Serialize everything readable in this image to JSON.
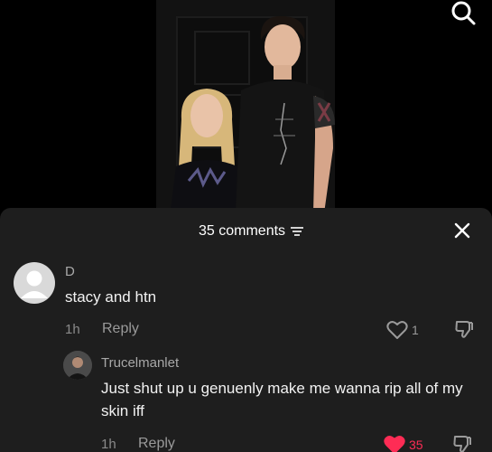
{
  "header": {
    "comment_count_label": "35 comments"
  },
  "comments": [
    {
      "username": "D",
      "text": "stacy and htn",
      "time": "1h",
      "reply_label": "Reply",
      "likes": "1",
      "liked": false
    },
    {
      "username": "Trucelmanlet",
      "text": "Just shut up u genuenly make me wanna rip all of my skin iff",
      "time": "1h",
      "reply_label": "Reply",
      "likes": "35",
      "liked": true
    }
  ],
  "colors": {
    "sheet_bg": "#1e1e1e",
    "like_active": "#fe2c55",
    "muted_text": "#8a8a8a"
  },
  "icons": {
    "search": "search-icon",
    "filter": "filter-icon",
    "close": "close-icon",
    "heart": "heart-icon",
    "dislike": "dislike-icon"
  }
}
